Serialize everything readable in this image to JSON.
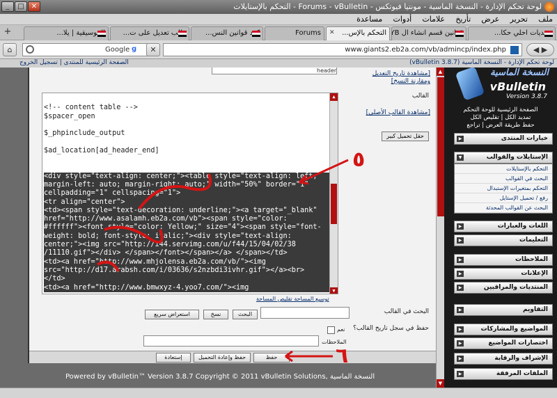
{
  "window": {
    "title": "لوحة تحكم الإدارة - النسخة الماسية - مونتيا فيوتكس - Forums - vBulletin - التحكم بالإستايلات"
  },
  "menu": [
    "ملف",
    "تحرير",
    "عرض",
    "تأريخ",
    "علامات",
    "أدوات",
    "مساعدة"
  ],
  "tabs": [
    {
      "label": "منتديات احلي حكا...",
      "flag": true,
      "active": false
    },
    {
      "label": "قوانين قسم انشاء ال YB",
      "flag": true,
      "active": false
    },
    {
      "label": "التحكم بالإس...",
      "flag": false,
      "active": true
    },
    {
      "label": "Forums",
      "flag": false,
      "active": false
    },
    {
      "label": "كود قوانين النس...",
      "flag": true,
      "active": false
    },
    {
      "label": "طلب تعديل على ت...",
      "flag": true,
      "active": false
    },
    {
      "label": "الموسيقية | يلا...",
      "flag": true,
      "active": false
    }
  ],
  "navbar": {
    "url": "www.giants2.eb2a.com/vb/admincp/index.php",
    "search_placeholder": "Google",
    "search_engine_icon": "g-icon"
  },
  "breadcrumb": {
    "right": "لوحة تحكم الإدارة - النسخة الماسية (vBulletin 3.8.7)",
    "left": "الصفحة الرئيسية للمنتدى | تسجيل الخروج"
  },
  "editor": {
    "header_field": "header",
    "history_link": "[مشاهدة تاريخ التعديل ومقارنة النسخ]",
    "template_label": "القالب",
    "original_link": "[مشاهدة القالب الأصلي]",
    "expand_button": "حقل تحميل كبير",
    "code_lines": [
      "",
      "<!-- content table -->",
      "$spacer_open",
      "",
      "$_phpinclude_output",
      "",
      "$ad_location[ad_header_end]",
      "",
      ""
    ],
    "selected_lines": [
      "<div style=\"text-align: center;\"><table style=\"text-align: left;",
      "margin-left: auto; margin-right: auto;\" width=\"50%\" border=\"1\"",
      "cellpadding=\"1\" cellspacing=\"1\">",
      "<tr align=\"center\">",
      "<td><span style=\"text-decoration: underline;\"><a target=\"_blank\"",
      "href=\"http://www.asalamh.eb2a.com/vb\"><span style=\"color:",
      "#ffffff\"><font style=\"color: Yellow;\" size=\"4\"><span style=\"font-",
      "weight: bold; font-style: italic;\"><div style=\"text-align:",
      "center;\"><img src=\"http://i44.servimg.com/u/f44/15/04/02/38",
      "/11110.gif\"></div> </span></font></span></a> </span></td>",
      "<td><a href=\"http://www.mhjolensa.eb2a.com/vb/\"><img",
      "src=\"http://d17.arabsh.com/i/03636/s2nzbdi3ivhr.gif\"></a><br>",
      "</td>",
      "<td><a href=\"http://www.bmwxyz-4.yoo7.com/\"><img"
    ],
    "wrap_note": "توسيع المساحة تقليص المساحة",
    "find_label": "البحث في القالب",
    "find_button": "البحث",
    "copy_button": "نسخ",
    "preview_button": "استعراض سريع",
    "keep_history_label": "حفظ في سجل تاريخ القالب؟",
    "yes_label": "نعم",
    "notes_label": "الملاحظات",
    "save_button": "حفظ",
    "save_reload_button": "حفظ وإعادة التحميل",
    "restore_button": "إستعادة"
  },
  "footer": {
    "text": "Powered by vBulletin™ Version 3.8.7 Copyright © 2011 vBulletin Solutions, النسخة الماسية"
  },
  "sidebar": {
    "logo_ar": "النسخة الماسية",
    "logo_vb": "vBulletin",
    "logo_version": "Version 3.8.7",
    "links": [
      "الصفحة الرئيسية للوحة التحكم",
      "تمديد الكل | تقليص الكل",
      "حفظ طريقة العرض | تراجع"
    ],
    "groups": [
      "خيارات المنتدى",
      "الإستايلات والقوالب",
      "اللغات والعبارات",
      "التعليمات",
      "الملاحظات",
      "الإعلانات",
      "المنتديات والمراقبين",
      "التقاويم",
      "المواضيع والمشاركات",
      "اختصارات المواضيع",
      "الإشراف والرقابة",
      "الملفات المرفقة"
    ],
    "subitems": [
      "التحكم بالإستايلات",
      "البحث في القوالب",
      "التحكم بمتغيرات الإستبدال",
      "رفع / تحميل الإستايل",
      "البحث عن القوالب المحدثة"
    ]
  },
  "annotations": {
    "five": "٥",
    "six": "٦"
  },
  "colors": {
    "accent": "#b01010",
    "annotation": "#d41414",
    "selection": "#3a3a3a"
  }
}
